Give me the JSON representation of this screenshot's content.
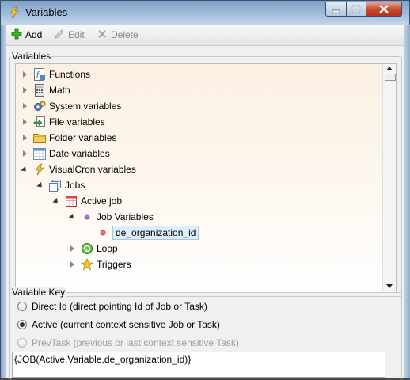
{
  "window": {
    "title": "Variables",
    "icon": "visualcron-lightning-icon"
  },
  "toolbar": {
    "add_label": "Add",
    "edit_label": "Edit",
    "delete_label": "Delete"
  },
  "variables_group": {
    "label": "Variables",
    "tree": {
      "functions": "Functions",
      "math": "Math",
      "system_variables": "System variables",
      "file_variables": "File variables",
      "folder_variables": "Folder variables",
      "date_variables": "Date variables",
      "visualcron_variables": "VisualCron variables",
      "jobs": "Jobs",
      "active_job": "Active job",
      "job_variables": "Job Variables",
      "selected_variable": "de_organization_id",
      "loop": "Loop",
      "triggers": "Triggers"
    }
  },
  "variable_key_group": {
    "label": "Variable Key",
    "options": {
      "direct_id": "Direct Id (direct pointing Id of Job or Task)",
      "active": "Active (current context sensitive Job or Task)",
      "prev_task": "PrevTask (previous or last context sensitive Task)"
    },
    "selected": "active"
  },
  "result": {
    "value": "{JOB(Active,Variable,de_organization_id)}"
  },
  "colors": {
    "accent": "#3b78c4",
    "close": "#c74a32",
    "tree_bg": "#fbf0e2"
  }
}
